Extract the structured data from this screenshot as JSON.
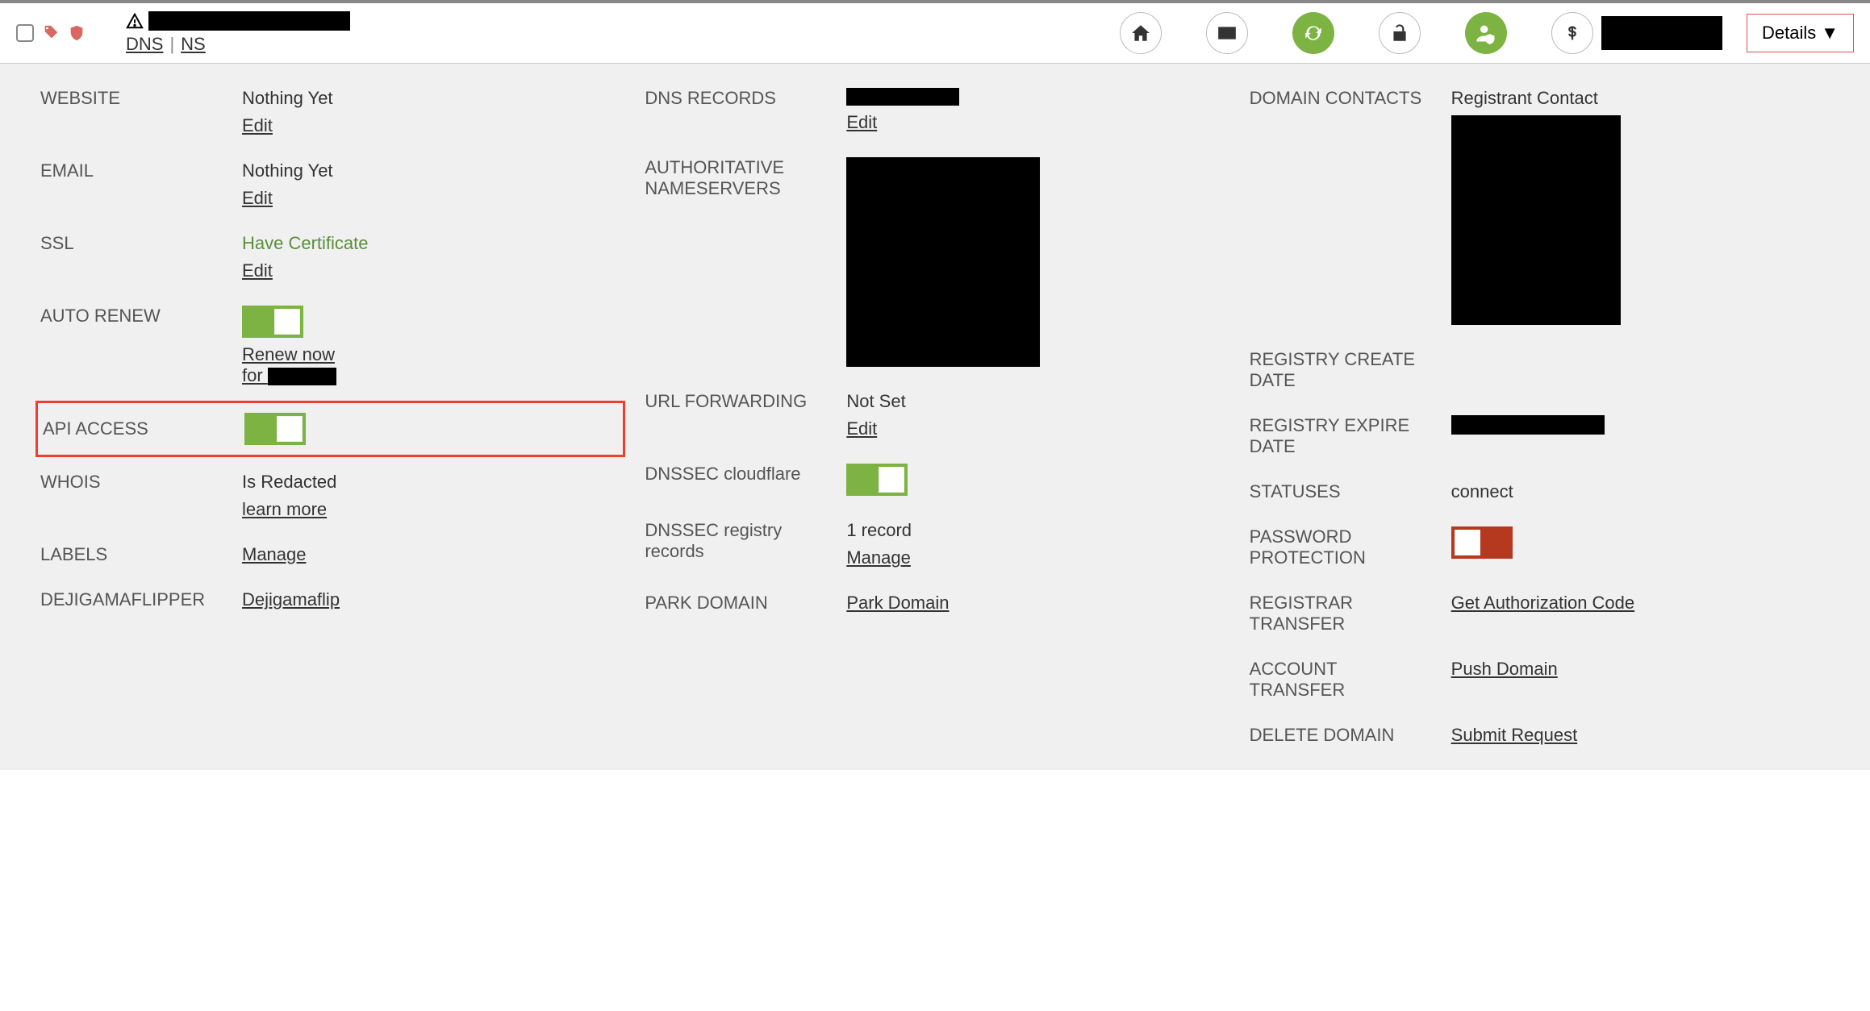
{
  "topbar": {
    "dns_label": "DNS",
    "ns_label": "NS",
    "details_label": "Details"
  },
  "col1": {
    "website": {
      "label": "WEBSITE",
      "value": "Nothing Yet",
      "edit": "Edit"
    },
    "email": {
      "label": "EMAIL",
      "value": "Nothing Yet",
      "edit": "Edit"
    },
    "ssl": {
      "label": "SSL",
      "value": "Have Certificate",
      "edit": "Edit"
    },
    "autorenew": {
      "label": "AUTO RENEW",
      "renew_now": "Renew now",
      "for": "for "
    },
    "apiaccess": {
      "label": "API ACCESS"
    },
    "whois": {
      "label": "WHOIS",
      "value": "Is Redacted",
      "learn": "learn more"
    },
    "labels": {
      "label": "LABELS",
      "manage": "Manage"
    },
    "dejig": {
      "label": "DEJIGAMAFLIPPER",
      "value": "Dejigamaflip"
    }
  },
  "col2": {
    "dnsrecords": {
      "label": "DNS RECORDS",
      "edit": "Edit"
    },
    "authns": {
      "label": "AUTHORITATIVE NAMESERVERS"
    },
    "urlfwd": {
      "label": "URL FORWARDING",
      "value": "Not Set",
      "edit": "Edit"
    },
    "dnssec_cf": {
      "label": "DNSSEC cloudflare"
    },
    "dnssec_reg": {
      "label": "DNSSEC registry records",
      "value": "1 record",
      "manage": "Manage"
    },
    "park": {
      "label": "PARK DOMAIN",
      "value": "Park Domain"
    }
  },
  "col3": {
    "contacts": {
      "label": "DOMAIN CONTACTS",
      "value": "Registrant Contact"
    },
    "create_date": {
      "label": "REGISTRY CREATE DATE"
    },
    "expire_date": {
      "label": "REGISTRY EXPIRE DATE"
    },
    "statuses": {
      "label": "STATUSES",
      "value": "connect"
    },
    "pwd": {
      "label": "PASSWORD PROTECTION"
    },
    "registrar_xfer": {
      "label": "REGISTRAR TRANSFER",
      "value": "Get Authorization Code"
    },
    "account_xfer": {
      "label": "ACCOUNT TRANSFER",
      "value": "Push Domain"
    },
    "delete": {
      "label": "DELETE DOMAIN",
      "value": "Submit Request"
    }
  }
}
